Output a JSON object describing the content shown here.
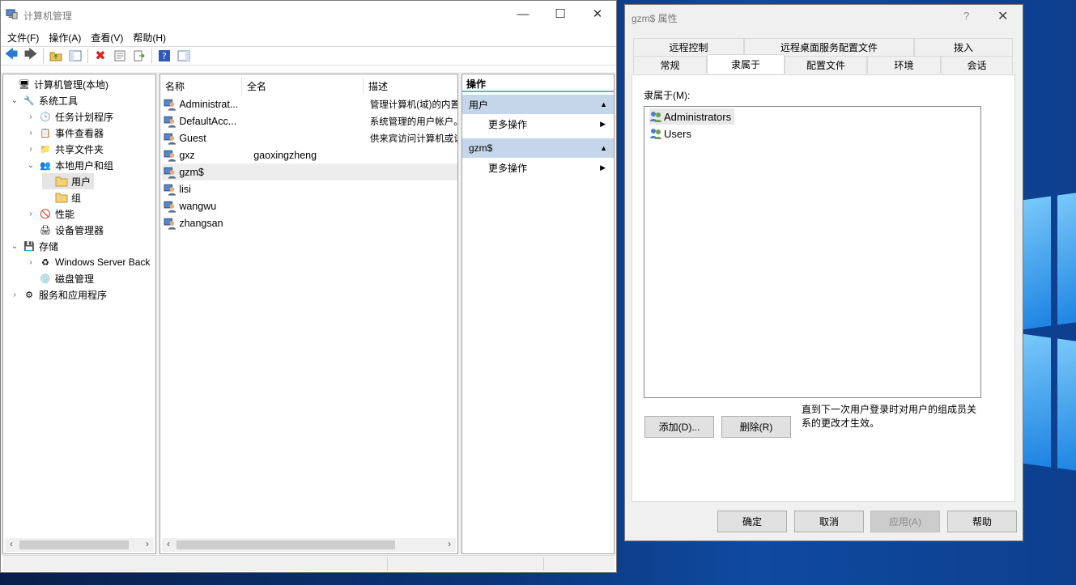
{
  "main_window": {
    "title": "计算机管理",
    "menu": [
      "文件(F)",
      "操作(A)",
      "查看(V)",
      "帮助(H)"
    ],
    "tree": [
      {
        "label": "计算机管理(本地)",
        "icon": "computer-manage-icon",
        "expander": ""
      },
      {
        "label": "系统工具",
        "icon": "tools-icon",
        "expander": "⌄"
      },
      {
        "label": "任务计划程序",
        "icon": "clock-icon",
        "expander": "›"
      },
      {
        "label": "事件查看器",
        "icon": "event-viewer-icon",
        "expander": "›"
      },
      {
        "label": "共享文件夹",
        "icon": "shared-folder-icon",
        "expander": "›"
      },
      {
        "label": "本地用户和组",
        "icon": "users-groups-icon",
        "expander": "⌄"
      },
      {
        "label": "用户",
        "icon": "folder-icon",
        "expander": ""
      },
      {
        "label": "组",
        "icon": "folder-icon",
        "expander": ""
      },
      {
        "label": "性能",
        "icon": "performance-icon",
        "expander": "›"
      },
      {
        "label": "设备管理器",
        "icon": "device-manager-icon",
        "expander": ""
      },
      {
        "label": "存储",
        "icon": "storage-icon",
        "expander": "⌄"
      },
      {
        "label": "Windows Server Back",
        "icon": "backup-icon",
        "expander": "›"
      },
      {
        "label": "磁盘管理",
        "icon": "disk-icon",
        "expander": ""
      },
      {
        "label": "服务和应用程序",
        "icon": "services-icon",
        "expander": "›"
      }
    ],
    "columns": [
      "名称",
      "全名",
      "描述"
    ],
    "users": [
      {
        "name": "Administrat...",
        "fullname": "",
        "desc": "管理计算机(域)的内置"
      },
      {
        "name": "DefaultAcc...",
        "fullname": "",
        "desc": "系统管理的用户帐户。"
      },
      {
        "name": "Guest",
        "fullname": "",
        "desc": "供来宾访问计算机或访"
      },
      {
        "name": "gxz",
        "fullname": "gaoxingzheng",
        "desc": ""
      },
      {
        "name": "gzm$",
        "fullname": "",
        "desc": ""
      },
      {
        "name": "lisi",
        "fullname": "",
        "desc": ""
      },
      {
        "name": "wangwu",
        "fullname": "",
        "desc": ""
      },
      {
        "name": "zhangsan",
        "fullname": "",
        "desc": ""
      }
    ],
    "actions": {
      "title": "操作",
      "section1": "用户",
      "section1_item": "更多操作",
      "section2": "gzm$",
      "section2_item": "更多操作"
    }
  },
  "dialog": {
    "title": "gzm$ 属性",
    "help_glyph": "?",
    "tabs_row1": [
      "远程控制",
      "远程桌面服务配置文件",
      "拨入"
    ],
    "tabs_row2": [
      "常规",
      "隶属于",
      "配置文件",
      "环境",
      "会话"
    ],
    "member_label": "隶属于(M):",
    "groups": [
      "Administrators",
      "Users"
    ],
    "add_button": "添加(D)...",
    "remove_button": "删除(R)",
    "note": "直到下一次用户登录时对用户的组成员关系的更改才生效。",
    "ok_button": "确定",
    "cancel_button": "取消",
    "apply_button": "应用(A)",
    "help_button": "帮助"
  },
  "colors": {
    "accent": "#1d86e6",
    "action_header": "#c5d6ea"
  }
}
